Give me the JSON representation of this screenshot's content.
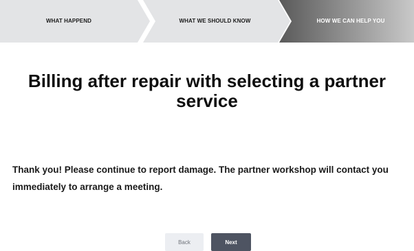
{
  "stepper": {
    "steps": [
      {
        "label": "WHAT HAPPEND",
        "state": "done"
      },
      {
        "label": "WHAT WE SHOULD KNOW",
        "state": "done"
      },
      {
        "label": "HOW WE CAN HELP YOU",
        "state": "active"
      }
    ],
    "colors": {
      "inactive": "#e3e4e6",
      "active_start": "#5a5a5a",
      "active_end": "#c9c9c9"
    }
  },
  "main": {
    "title": "Billing after repair  with selecting a partner service",
    "message": "Thank you! Please continue to report damage. The partner workshop will contact you immediately to arrange a meeting."
  },
  "actions": {
    "back_label": "Back",
    "next_label": "Next"
  }
}
